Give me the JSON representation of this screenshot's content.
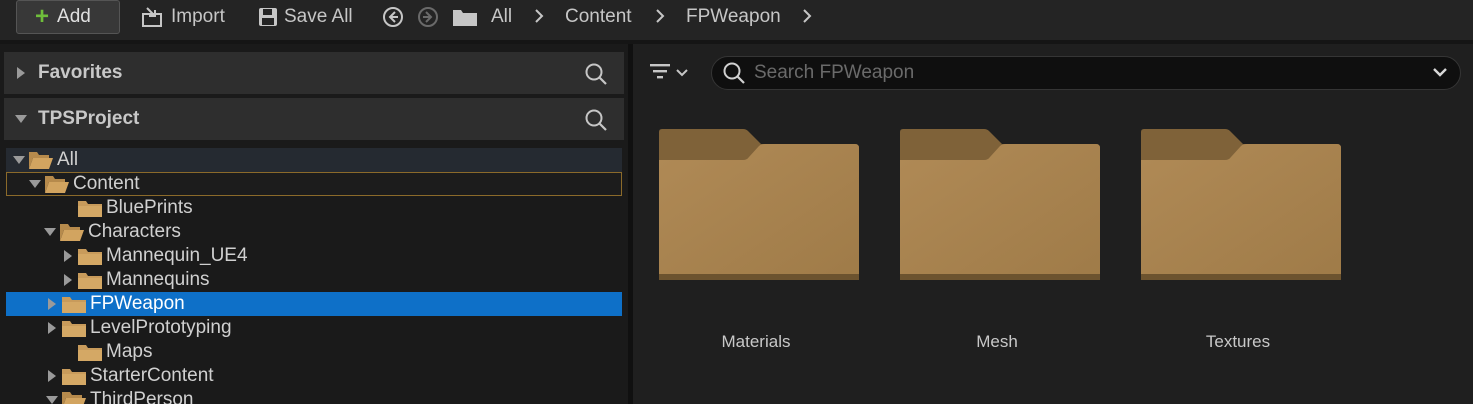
{
  "toolbar": {
    "add_label": "Add",
    "import_label": "Import",
    "save_all_label": "Save All",
    "breadcrumb": [
      "All",
      "Content",
      "FPWeapon"
    ]
  },
  "left_panel": {
    "favorites_label": "Favorites",
    "project_label": "TPSProject",
    "tree": [
      {
        "label": "All",
        "state": "expanded"
      },
      {
        "label": "Content",
        "state": "expanded"
      },
      {
        "label": "BluePrints",
        "state": "leaf"
      },
      {
        "label": "Characters",
        "state": "expanded"
      },
      {
        "label": "Mannequin_UE4",
        "state": "collapsed"
      },
      {
        "label": "Mannequins",
        "state": "collapsed"
      },
      {
        "label": "FPWeapon",
        "state": "collapsed",
        "selected": true
      },
      {
        "label": "LevelPrototyping",
        "state": "collapsed"
      },
      {
        "label": "Maps",
        "state": "leaf"
      },
      {
        "label": "StarterContent",
        "state": "collapsed"
      },
      {
        "label": "ThirdPerson",
        "state": "expanded"
      }
    ]
  },
  "right_panel": {
    "search_placeholder": "Search FPWeapon",
    "assets": [
      {
        "label": "Materials",
        "icon": "folder-icon"
      },
      {
        "label": "Mesh",
        "icon": "folder-icon"
      },
      {
        "label": "Textures",
        "icon": "folder-icon"
      }
    ]
  },
  "colors": {
    "selection": "#0e70c8",
    "folder": "#a8814d",
    "add_plus": "#6fbe3b",
    "hover_border": "#8b6a2a"
  }
}
